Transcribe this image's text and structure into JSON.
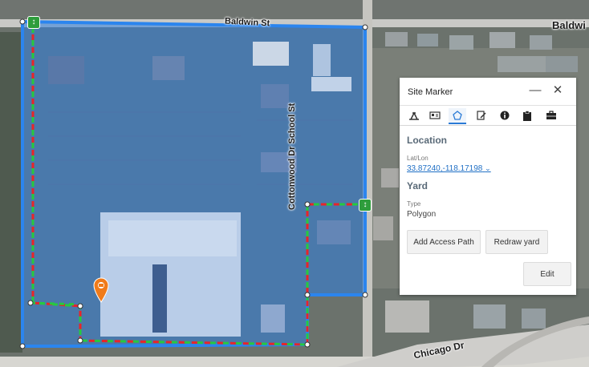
{
  "map": {
    "streets": {
      "north_left": "Baldwin St",
      "north_right": "Baldwi",
      "east": "Cottonwood Dr School St",
      "south": "Chicago Dr"
    },
    "colors": {
      "site_fill": "#2f7fe0",
      "site_border": "#2b85ee",
      "path_red": "#e8242a",
      "path_green": "#27c93f",
      "handle": "#2e9d3c",
      "marker": "#f07b1a"
    },
    "icons": {
      "handle": "resize-vertical-icon",
      "marker": "location-pin-icon"
    }
  },
  "panel": {
    "title": "Site Marker",
    "controls": {
      "minimize": "—",
      "close": "✕"
    },
    "toolbar": [
      {
        "name": "tool-site-icon"
      },
      {
        "name": "tool-card-icon"
      },
      {
        "name": "tool-polygon-icon",
        "active": true
      },
      {
        "name": "tool-edit-note-icon"
      },
      {
        "name": "tool-info-icon"
      },
      {
        "name": "tool-clipboard-icon"
      },
      {
        "name": "tool-briefcase-icon"
      }
    ],
    "location": {
      "heading": "Location",
      "latlon_label": "Lat/Lon",
      "latlon_value": "33.87240,-118.17198"
    },
    "yard": {
      "heading": "Yard",
      "type_label": "Type",
      "type_value": "Polygon"
    },
    "buttons": {
      "add_access_path": "Add Access Path",
      "redraw_yard": "Redraw yard",
      "edit": "Edit"
    }
  }
}
